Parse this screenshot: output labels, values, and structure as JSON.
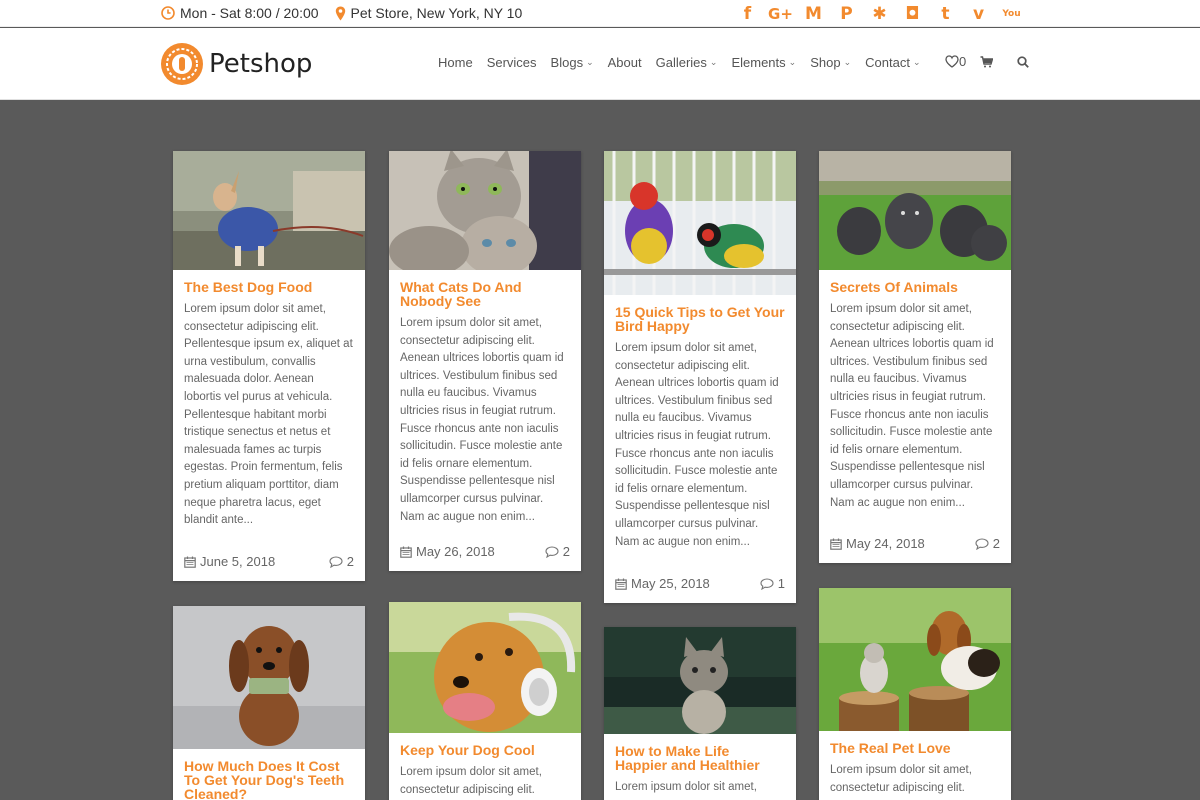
{
  "topbar": {
    "hours": "Mon - Sat 8:00 / 20:00",
    "location": "Pet Store, New York, NY 10",
    "social": [
      "f",
      "G+",
      "M",
      "P",
      "✱",
      "◘",
      "t",
      "v",
      "You"
    ]
  },
  "header": {
    "brand": "Petshop",
    "nav": [
      {
        "label": "Home",
        "dropdown": false
      },
      {
        "label": "Services",
        "dropdown": false
      },
      {
        "label": "Blogs",
        "dropdown": true
      },
      {
        "label": "About",
        "dropdown": false
      },
      {
        "label": "Galleries",
        "dropdown": true
      },
      {
        "label": "Elements",
        "dropdown": true
      },
      {
        "label": "Shop",
        "dropdown": true
      },
      {
        "label": "Contact",
        "dropdown": true
      }
    ],
    "wishlist_count": "0"
  },
  "posts": [
    {
      "title": "The Best Dog Food",
      "excerpt": "Lorem ipsum dolor sit amet, consectetur adipiscing elit. Pellentesque ipsum ex, aliquet at urna vestibulum, convallis malesuada dolor. Aenean lobortis vel purus at vehicula. Pellentesque habitant morbi tristique senectus et netus et malesuada fames ac turpis egestas. Proin fermentum, felis pretium aliquam porttitor, diam neque pharetra lacus, eget blandit ante...",
      "date": "June 5, 2018",
      "comments": "2"
    },
    {
      "title": "What Cats Do And Nobody See",
      "excerpt": "Lorem ipsum dolor sit amet, consectetur adipiscing elit. Aenean ultrices lobortis quam id ultrices. Vestibulum finibus sed nulla eu faucibus. Vivamus ultricies risus in feugiat rutrum. Fusce rhoncus ante non iaculis sollicitudin. Fusce molestie ante id felis ornare elementum. Suspendisse pellentesque nisl ullamcorper cursus pulvinar. Nam ac augue non enim...",
      "date": "May 26, 2018",
      "comments": "2"
    },
    {
      "title": "15 Quick Tips to Get Your Bird Happy",
      "excerpt": "Lorem ipsum dolor sit amet, consectetur adipiscing elit. Aenean ultrices lobortis quam id ultrices. Vestibulum finibus sed nulla eu faucibus. Vivamus ultricies risus in feugiat rutrum. Fusce rhoncus ante non iaculis sollicitudin. Fusce molestie ante id felis ornare elementum. Suspendisse pellentesque nisl ullamcorper cursus pulvinar. Nam ac augue non enim...",
      "date": "May 25, 2018",
      "comments": "1"
    },
    {
      "title": "Secrets Of Animals",
      "excerpt": "Lorem ipsum dolor sit amet, consectetur adipiscing elit. Aenean ultrices lobortis quam id ultrices. Vestibulum finibus sed nulla eu faucibus. Vivamus ultricies risus in feugiat rutrum. Fusce rhoncus ante non iaculis sollicitudin. Fusce molestie ante id felis ornare elementum. Suspendisse pellentesque nisl ullamcorper cursus pulvinar. Nam ac augue non enim...",
      "date": "May 24, 2018",
      "comments": "2"
    },
    {
      "title": "How Much Does It Cost To Get Your Dog's Teeth Cleaned?",
      "excerpt": "",
      "date": "",
      "comments": ""
    },
    {
      "title": "Keep Your Dog Cool",
      "excerpt": "Lorem ipsum dolor sit amet, consectetur adipiscing elit.",
      "date": "",
      "comments": ""
    },
    {
      "title": "How to Make Life Happier and Healthier",
      "excerpt": "Lorem ipsum dolor sit amet,",
      "date": "",
      "comments": ""
    },
    {
      "title": "The Real Pet Love",
      "excerpt": "Lorem ipsum dolor sit amet, consectetur adipiscing elit.",
      "date": "",
      "comments": ""
    }
  ],
  "colors": {
    "accent": "#f28a2e",
    "page_bg": "#5a5a5a"
  },
  "icons": [
    "clock-icon",
    "map-pin-icon",
    "heart-icon",
    "cart-icon",
    "search-icon",
    "calendar-icon",
    "comment-icon"
  ]
}
